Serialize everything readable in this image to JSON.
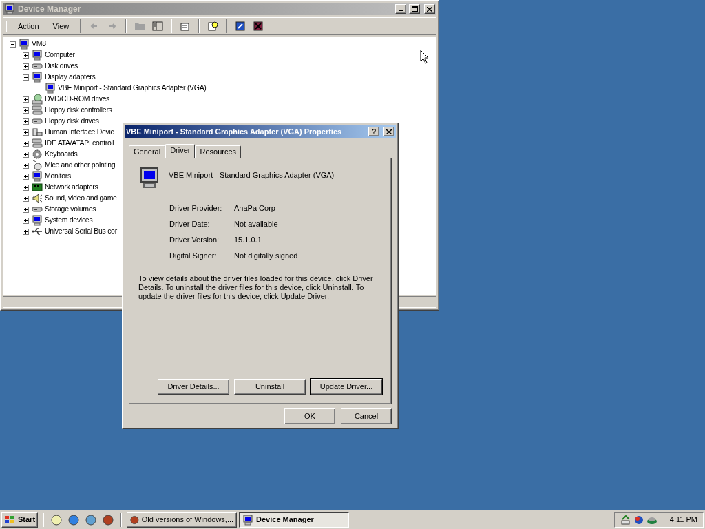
{
  "device_manager": {
    "title": "Device Manager",
    "active": false,
    "menu": [
      "Action",
      "View"
    ],
    "toolbar": [
      {
        "disabled": true
      },
      {
        "disabled": true
      },
      {
        "disabled": true
      },
      {
        "disabled": false
      },
      {
        "disabled": false
      },
      {
        "disabled": false
      },
      {
        "disabled": false
      },
      {
        "disabled": false
      }
    ],
    "tree": [
      {
        "label": "VM8",
        "expanded": true,
        "children": [
          {
            "label": "Computer",
            "expanded": false
          },
          {
            "label": "Disk drives",
            "expanded": false
          },
          {
            "label": "Display adapters",
            "expanded": true,
            "children": [
              {
                "label": "VBE Miniport - Standard Graphics Adapter (VGA)"
              }
            ]
          },
          {
            "label": "DVD/CD-ROM drives",
            "expanded": false
          },
          {
            "label": "Floppy disk controllers",
            "expanded": false
          },
          {
            "label": "Floppy disk drives",
            "expanded": false
          },
          {
            "label": "Human Interface Devic",
            "expanded": false
          },
          {
            "label": "IDE ATA/ATAPI controll",
            "expanded": false
          },
          {
            "label": "Keyboards",
            "expanded": false
          },
          {
            "label": "Mice and other pointing",
            "expanded": false
          },
          {
            "label": "Monitors",
            "expanded": false
          },
          {
            "label": "Network adapters",
            "expanded": false
          },
          {
            "label": "Sound, video and game",
            "expanded": false
          },
          {
            "label": "Storage volumes",
            "expanded": false
          },
          {
            "label": "System devices",
            "expanded": false
          },
          {
            "label": "Universal Serial Bus cor",
            "expanded": false
          }
        ]
      }
    ]
  },
  "dialog": {
    "title": "VBE Miniport - Standard Graphics Adapter (VGA) Properties",
    "active": true,
    "help_button": "?",
    "tabs": [
      {
        "label": "General",
        "selected": false
      },
      {
        "label": "Driver",
        "selected": true
      },
      {
        "label": "Resources",
        "selected": false
      }
    ],
    "device_name": "VBE Miniport - Standard Graphics Adapter (VGA)",
    "fields": [
      {
        "label": "Driver Provider:",
        "value": "AnaPa Corp"
      },
      {
        "label": "Driver Date:",
        "value": "Not available"
      },
      {
        "label": "Driver Version:",
        "value": "15.1.0.1"
      },
      {
        "label": "Digital Signer:",
        "value": "Not digitally signed"
      }
    ],
    "description": "To view details about the driver files loaded for this device, click Driver Details. To uninstall the driver files for this device, click Uninstall. To update the driver files for this device, click Update Driver.",
    "actions": [
      {
        "label": "Driver Details...",
        "default": false
      },
      {
        "label": "Uninstall",
        "default": false
      },
      {
        "label": "Update Driver...",
        "default": true
      }
    ],
    "buttons": [
      {
        "label": "OK",
        "default": false
      },
      {
        "label": "Cancel",
        "default": false
      }
    ]
  },
  "taskbar": {
    "start": "Start",
    "tasks": [
      {
        "label": "Old versions of Windows,...",
        "selected": false
      },
      {
        "label": "Device Manager",
        "selected": true
      }
    ],
    "clock": "4:11 PM"
  }
}
